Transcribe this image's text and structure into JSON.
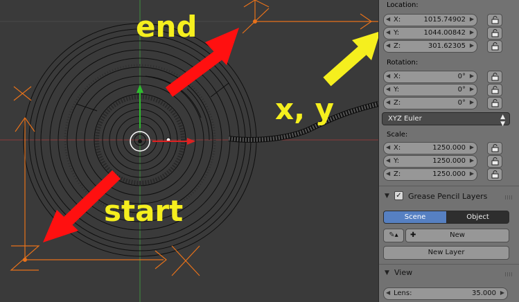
{
  "annotations": {
    "end": "end",
    "start": "start",
    "xy": "x, y"
  },
  "colors": {
    "arrow_red": "#ff1010",
    "arrow_yellow": "#f5ef1e",
    "object_orange": "#e8721a",
    "axis_green": "#3aa83a",
    "axis_red": "#b33a3a",
    "selected_blue": "#5680c2"
  },
  "location": {
    "label": "Location:",
    "fields": [
      {
        "axis": "X:",
        "value": "1015.74902"
      },
      {
        "axis": "Y:",
        "value": "1044.00842"
      },
      {
        "axis": "Z:",
        "value": "301.62305"
      }
    ]
  },
  "rotation": {
    "label": "Rotation:",
    "fields": [
      {
        "axis": "X:",
        "value": "0°"
      },
      {
        "axis": "Y:",
        "value": "0°"
      },
      {
        "axis": "Z:",
        "value": "0°"
      }
    ],
    "mode": "XYZ Euler"
  },
  "scale": {
    "label": "Scale:",
    "fields": [
      {
        "axis": "X:",
        "value": "1250.000"
      },
      {
        "axis": "Y:",
        "value": "1250.000"
      },
      {
        "axis": "Z:",
        "value": "1250.000"
      }
    ]
  },
  "grease_pencil": {
    "title": "Grease Pencil Layers",
    "tab_scene": "Scene",
    "tab_object": "Object",
    "new_label": "New",
    "new_layer_label": "New Layer"
  },
  "view": {
    "title": "View",
    "lens_label": "Lens:",
    "lens_value": "35.000"
  }
}
